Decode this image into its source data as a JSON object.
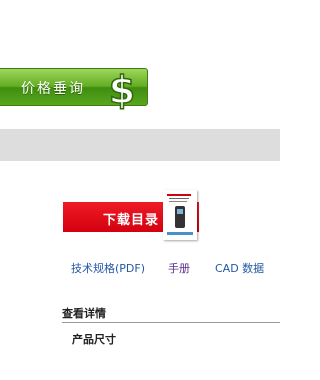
{
  "price_inquiry": {
    "label": "价格垂询",
    "icon": "dollar-icon"
  },
  "download": {
    "label": "下载目录",
    "thumbnail": "catalog-thumbnail"
  },
  "links": {
    "tech_spec": "技术规格(PDF)",
    "manual": "手册",
    "cad": "CAD 数据"
  },
  "details": {
    "title": "查看详情",
    "dimensions": "产品尺寸"
  },
  "colors": {
    "price_button": "#62ad22",
    "download_button": "#e60012",
    "grey_band": "#dddddd",
    "link_blue": "#2358a6",
    "link_purple": "#5a2e8e"
  }
}
